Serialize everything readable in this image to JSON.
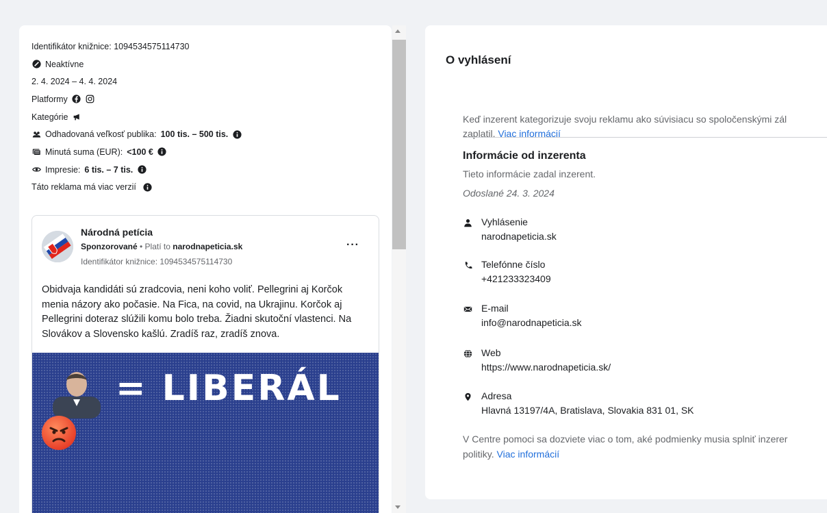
{
  "ad_meta": {
    "library_id": "Identifikátor knižnice: 1094534575114730",
    "status": "Neaktívne",
    "dates": "2. 4. 2024 – 4. 4. 2024",
    "platforms_label": "Platformy",
    "categories_label": "Kategórie",
    "audience_label": "Odhadovaná veľkosť publika:",
    "audience_value": "100 tis. – 500 tis.",
    "spend_label": "Minutá suma (EUR):",
    "spend_value": "<100 €",
    "impressions_label": "Impresie:",
    "impressions_value": "6 tis. – 7 tis.",
    "versions_note": "Táto reklama má viac verzií"
  },
  "post": {
    "page_name": "Národná petícia",
    "sponsored": "Sponzorované",
    "paid_by_prefix": " • Platí to ",
    "paid_by": "narodnapeticia.sk",
    "library_id": "Identifikátor knižnice: 1094534575114730",
    "more": "···",
    "body": "Obidvaja kandidáti sú zradcovia, neni koho voliť. Pellegrini aj Korčok menia názory ako počasie. Na Fica, na covid, na Ukrajinu. Korčok aj Pellegrini doteraz slúžili komu bolo treba. Žiadni skutoční vlastenci. Na Slovákov a Slovensko kašlú.  Zradíš raz, zradíš znova.",
    "image_text": "= LIBERÁL"
  },
  "about": {
    "title": "O vyhlásení",
    "text": "Keď inzerent kategorizuje svoju reklamu ako súvisiacu so spoločenskými zál",
    "text_line2": "zaplatil. ",
    "more_link": "Viac informácií"
  },
  "advertiser": {
    "title": "Informácie od inzerenta",
    "subtitle": "Tieto informácie zadal inzerent.",
    "submitted": "Odoslané 24. 3. 2024",
    "contacts": [
      {
        "icon": "person-icon",
        "label": "Vyhlásenie",
        "value": "narodnapeticia.sk"
      },
      {
        "icon": "phone-icon",
        "label": "Telefónne číslo",
        "value": "+421233323409"
      },
      {
        "icon": "envelope-icon",
        "label": "E-mail",
        "value": "info@narodnapeticia.sk"
      },
      {
        "icon": "globe-icon",
        "label": "Web",
        "value": "https://www.narodnapeticia.sk/"
      },
      {
        "icon": "location-pin-icon",
        "label": "Adresa",
        "value": "Hlavná 13197/4A, Bratislava, Slovakia 831 01, SK"
      }
    ],
    "footer": "V Centre pomoci sa dozviete viac o tom, aké podmienky musia splniť inzerer",
    "footer_line2": "politiky. ",
    "footer_link": "Viac informácií"
  }
}
